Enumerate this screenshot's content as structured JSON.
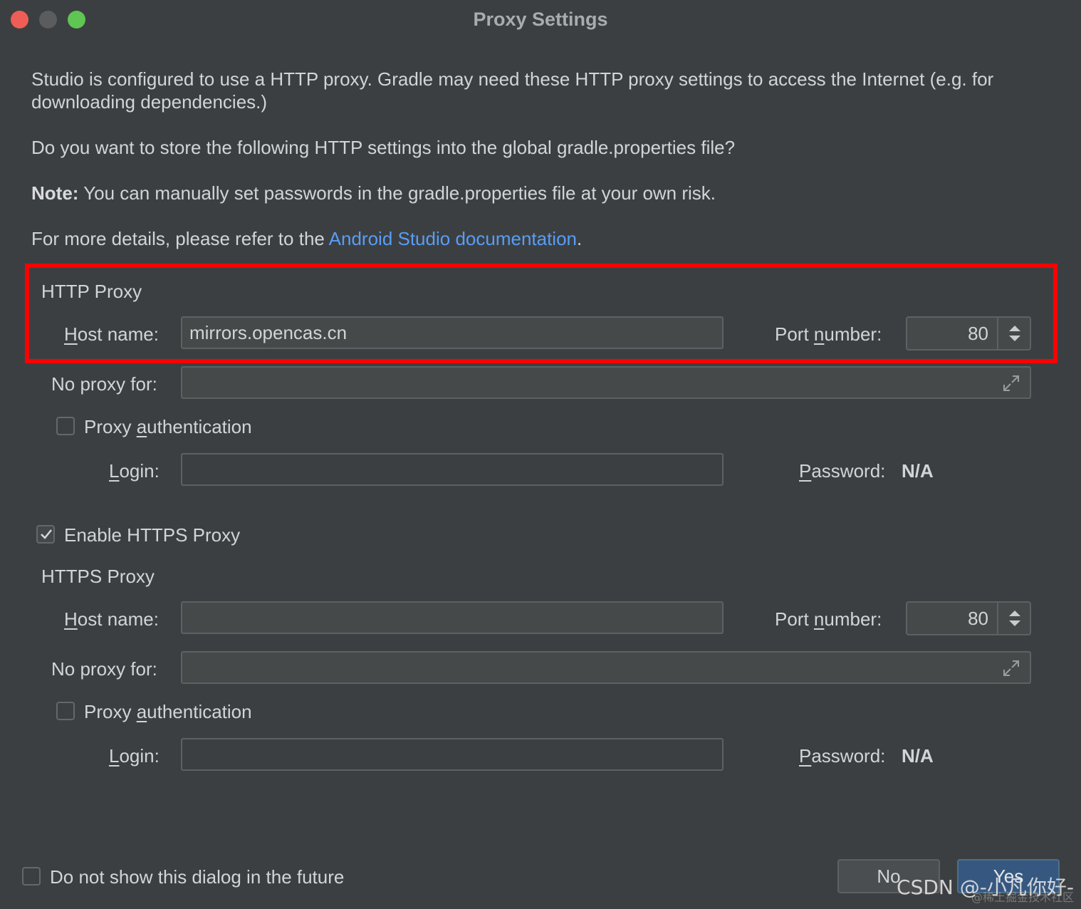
{
  "window": {
    "title": "Proxy Settings"
  },
  "intro": {
    "p1": "Studio is configured to use a HTTP proxy. Gradle may need these HTTP proxy settings to access the Internet (e.g. for downloading dependencies.)",
    "p2": "Do you want to store the following HTTP settings into the global gradle.properties file?",
    "p3_bold": "Note:",
    "p3_rest": " You can manually set passwords in the gradle.properties file at your own risk.",
    "p4_prefix": "For more details, please refer to the ",
    "p4_link": "Android Studio documentation",
    "p4_suffix": "."
  },
  "http": {
    "section_title": "HTTP Proxy",
    "host_label_u": "H",
    "host_label_rest": "ost name:",
    "host_value": "mirrors.opencas.cn",
    "port_label_pre": "Port ",
    "port_label_u": "n",
    "port_label_rest": "umber:",
    "port_value": "80",
    "no_proxy_label": "No proxy for:",
    "no_proxy_value": "",
    "auth_label_pre": "Proxy ",
    "auth_label_u": "a",
    "auth_label_rest": "uthentication",
    "auth_checked": false,
    "login_label_u": "L",
    "login_label_rest": "ogin:",
    "login_value": "",
    "password_label_u": "P",
    "password_label_rest": "assword:",
    "password_value": "N/A"
  },
  "https_toggle": {
    "label": "Enable HTTPS Proxy",
    "checked": true
  },
  "https": {
    "section_title": "HTTPS Proxy",
    "host_label_u": "H",
    "host_label_rest": "ost name:",
    "host_value": "",
    "port_label_pre": "Port ",
    "port_label_u": "n",
    "port_label_rest": "umber:",
    "port_value": "80",
    "no_proxy_label": "No proxy for:",
    "no_proxy_value": "",
    "auth_label_pre": "Proxy ",
    "auth_label_u": "a",
    "auth_label_rest": "uthentication",
    "auth_checked": false,
    "login_label_u": "L",
    "login_label_rest": "ogin:",
    "login_value": "",
    "password_label_u": "P",
    "password_label_rest": "assword:",
    "password_value": "N/A"
  },
  "footer": {
    "dont_show_label": "Do not show this dialog in the future",
    "dont_show_checked": false,
    "no_button": "No",
    "yes_button": "Yes"
  },
  "watermark": {
    "text": "CSDN @-小凡你好-",
    "subtext": "@稀土掘金技术社区"
  },
  "colors": {
    "background": "#3c3f41",
    "link": "#589df6",
    "highlight_box": "#ff0000",
    "yes_button": "#365880"
  }
}
